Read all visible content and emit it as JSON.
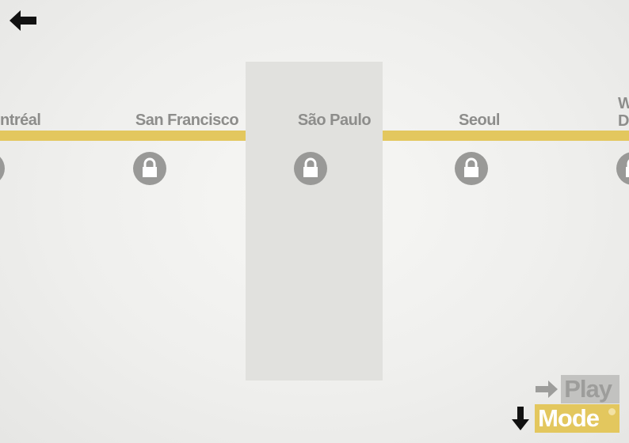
{
  "header": {
    "back_icon": "arrow-left-icon"
  },
  "level_select": {
    "cities": [
      {
        "name": "ntréal",
        "lock_icon": "lock-icon",
        "locked": true
      },
      {
        "name": "San Francisco",
        "lock_icon": "lock-icon",
        "locked": true
      },
      {
        "name": "São Paulo",
        "lock_icon": "lock-icon",
        "locked": true,
        "selected": true
      },
      {
        "name": "Seoul",
        "lock_icon": "lock-icon",
        "locked": true
      },
      {
        "name_line1": "W",
        "name_line2": "D",
        "lock_icon": "lock-icon",
        "locked": true
      }
    ],
    "line_color": "#e3c75e",
    "lock_color": "#999997",
    "selected_column_color": "#e1e1de"
  },
  "menu": {
    "play_label": "Play",
    "mode_label": "Mode",
    "play_icon": "arrow-right-icon",
    "mode_icon": "arrow-down-icon",
    "accent_color": "#e3c75e"
  }
}
